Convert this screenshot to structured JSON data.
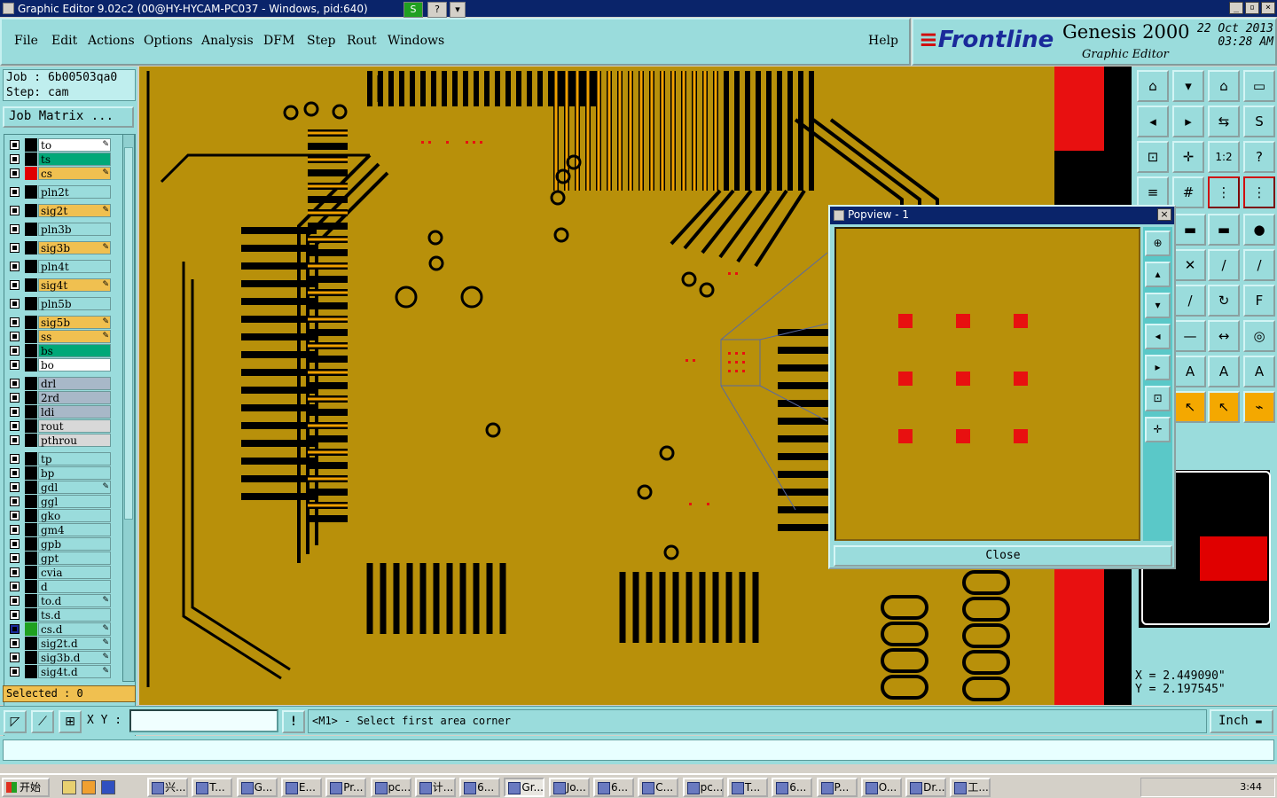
{
  "window": {
    "title": "Graphic Editor 9.02c2 (00@HY-HYCAM-PC037 - Windows, pid:640)",
    "mini_buttons": [
      "S",
      "?",
      "▾"
    ],
    "controls": [
      "_",
      "▫",
      "×"
    ]
  },
  "menu": {
    "items": [
      "File",
      "Edit",
      "Actions",
      "Options",
      "Analysis",
      "DFM",
      "Step",
      "Rout",
      "Windows"
    ],
    "help": "Help"
  },
  "brand": {
    "logo": "Frontline",
    "product": "Genesis 2000",
    "subtitle": "Graphic Editor",
    "date": "22 Oct 2013",
    "time": "03:28 AM"
  },
  "job": {
    "job_line": "Job : 6b00503qa0",
    "step_line": "Step: cam",
    "matrix_button": "Job Matrix ..."
  },
  "layers": [
    {
      "name": "to",
      "color": "#ffffff",
      "sw": "#000000",
      "edit": true
    },
    {
      "name": "ts",
      "color": "#00a878",
      "sw": "#000000",
      "edit": false
    },
    {
      "name": "cs",
      "color": "#f0c050",
      "sw": "#e00000",
      "edit": true
    },
    {
      "name": "pln2t",
      "color": "#9adcdc",
      "sw": "#000000",
      "edit": false
    },
    {
      "name": "sig2t",
      "color": "#f0c050",
      "sw": "#000000",
      "edit": true
    },
    {
      "name": "pln3b",
      "color": "#9adcdc",
      "sw": "#000000",
      "edit": false
    },
    {
      "name": "sig3b",
      "color": "#f0c050",
      "sw": "#000000",
      "edit": true
    },
    {
      "name": "pln4t",
      "color": "#9adcdc",
      "sw": "#000000",
      "edit": false
    },
    {
      "name": "sig4t",
      "color": "#f0c050",
      "sw": "#000000",
      "edit": true
    },
    {
      "name": "pln5b",
      "color": "#9adcdc",
      "sw": "#000000",
      "edit": false
    },
    {
      "name": "sig5b",
      "color": "#f0c050",
      "sw": "#000000",
      "edit": true
    },
    {
      "name": "ss",
      "color": "#f0c050",
      "sw": "#000000",
      "edit": true
    },
    {
      "name": "bs",
      "color": "#00a878",
      "sw": "#000000",
      "edit": false
    },
    {
      "name": "bo",
      "color": "#ffffff",
      "sw": "#000000",
      "edit": false
    },
    {
      "name": "drl",
      "color": "#a8b8c8",
      "sw": "#000000",
      "edit": false
    },
    {
      "name": "2rd",
      "color": "#a8b8c8",
      "sw": "#000000",
      "edit": false
    },
    {
      "name": "ldi",
      "color": "#a8b8c8",
      "sw": "#000000",
      "edit": false
    },
    {
      "name": "rout",
      "color": "#d8d8d8",
      "sw": "#000000",
      "edit": false
    },
    {
      "name": "pthrou",
      "color": "#d8d8d8",
      "sw": "#000000",
      "edit": false
    },
    {
      "name": "tp",
      "color": "#9adcdc",
      "sw": "#000000",
      "edit": false
    },
    {
      "name": "bp",
      "color": "#9adcdc",
      "sw": "#000000",
      "edit": false
    },
    {
      "name": "gdl",
      "color": "#9adcdc",
      "sw": "#000000",
      "edit": true
    },
    {
      "name": "ggl",
      "color": "#9adcdc",
      "sw": "#000000",
      "edit": false
    },
    {
      "name": "gko",
      "color": "#9adcdc",
      "sw": "#000000",
      "edit": false
    },
    {
      "name": "gm4",
      "color": "#9adcdc",
      "sw": "#000000",
      "edit": false
    },
    {
      "name": "gpb",
      "color": "#9adcdc",
      "sw": "#000000",
      "edit": false
    },
    {
      "name": "gpt",
      "color": "#9adcdc",
      "sw": "#000000",
      "edit": false
    },
    {
      "name": "cvia",
      "color": "#9adcdc",
      "sw": "#000000",
      "edit": false
    },
    {
      "name": "d",
      "color": "#9adcdc",
      "sw": "#000000",
      "edit": false
    },
    {
      "name": "to.d",
      "color": "#9adcdc",
      "sw": "#000000",
      "edit": true
    },
    {
      "name": "ts.d",
      "color": "#9adcdc",
      "sw": "#000000",
      "edit": false
    },
    {
      "name": "cs.d",
      "color": "#9adcdc",
      "sw": "#20a020",
      "edit": true,
      "active": true
    },
    {
      "name": "sig2t.d",
      "color": "#9adcdc",
      "sw": "#000000",
      "edit": true
    },
    {
      "name": "sig3b.d",
      "color": "#9adcdc",
      "sw": "#000000",
      "edit": true
    },
    {
      "name": "sig4t.d",
      "color": "#9adcdc",
      "sw": "#000000",
      "edit": true
    }
  ],
  "selected": "Selected : 0",
  "popview": {
    "title": "Popview - 1",
    "close": "Close"
  },
  "coords": {
    "x": "X = 2.449090\"",
    "y": "Y = 2.197545\""
  },
  "command": {
    "xy_label": "X Y :",
    "xy_value": "",
    "warn": "!",
    "prompt": "<M1> - Select first area corner",
    "units": "Inch"
  },
  "taskbar": {
    "start": "开始",
    "apps": [
      "兴...",
      "T...",
      "G...",
      "E...",
      "Pr...",
      "pc...",
      "计...",
      "6...",
      "Gr...",
      "Jo...",
      "6...",
      "C...",
      "pc...",
      "T...",
      "6...",
      "P...",
      "O...",
      "Dr...",
      "工..."
    ],
    "active_index": 8,
    "clock": "3:44"
  },
  "colors": {
    "board": "#b8900a",
    "copper": "#f0a000",
    "pad": "#e81010",
    "panel": "#9adcdc"
  }
}
